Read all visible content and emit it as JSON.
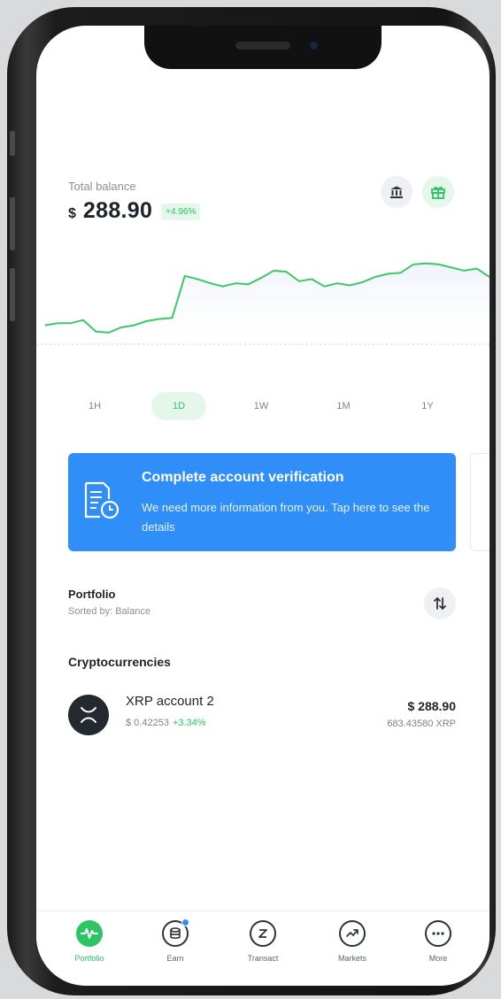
{
  "balance": {
    "label": "Total balance",
    "currency": "$",
    "value": "288.90",
    "change": "+4.96%"
  },
  "header_icons": {
    "bank": "bank-icon",
    "gift": "gift-icon"
  },
  "chart_data": {
    "type": "line",
    "color": "#3cc864",
    "values": [
      18,
      20,
      20,
      23,
      12,
      11,
      16,
      18,
      22,
      24,
      25,
      65,
      62,
      58,
      55,
      58,
      57,
      63,
      70,
      69,
      60,
      62,
      55,
      58,
      56,
      59,
      64,
      67,
      68,
      76,
      77,
      76,
      73,
      70,
      72,
      64
    ]
  },
  "periods": [
    {
      "label": "1H",
      "active": false
    },
    {
      "label": "1D",
      "active": true
    },
    {
      "label": "1W",
      "active": false
    },
    {
      "label": "1M",
      "active": false
    },
    {
      "label": "1Y",
      "active": false
    }
  ],
  "verification": {
    "title": "Complete account verification",
    "text": "We need more information from you. Tap here to see the details",
    "icon": "document-clock-icon"
  },
  "portfolio": {
    "title": "Portfolio",
    "sorted_by": "Sorted by: Balance",
    "filter_icon": "sort-icon"
  },
  "section_title": "Cryptocurrencies",
  "assets": [
    {
      "name": "XRP account 2",
      "price": "$ 0.42253",
      "change": "+3.34%",
      "value": "$ 288.90",
      "amount": "683.43580 XRP",
      "icon": "xrp-icon"
    }
  ],
  "tabs": [
    {
      "label": "Portfolio",
      "icon": "pulse-icon",
      "active": true
    },
    {
      "label": "Earn",
      "icon": "coins-icon",
      "active": false,
      "badge": true
    },
    {
      "label": "Transact",
      "icon": "transact-icon",
      "active": false
    },
    {
      "label": "Markets",
      "icon": "markets-icon",
      "active": false
    },
    {
      "label": "More",
      "icon": "more-icon",
      "active": false
    }
  ],
  "colors": {
    "accent_green": "#2ec364",
    "accent_blue": "#2f8ef8",
    "text_dark": "#1e2229"
  }
}
